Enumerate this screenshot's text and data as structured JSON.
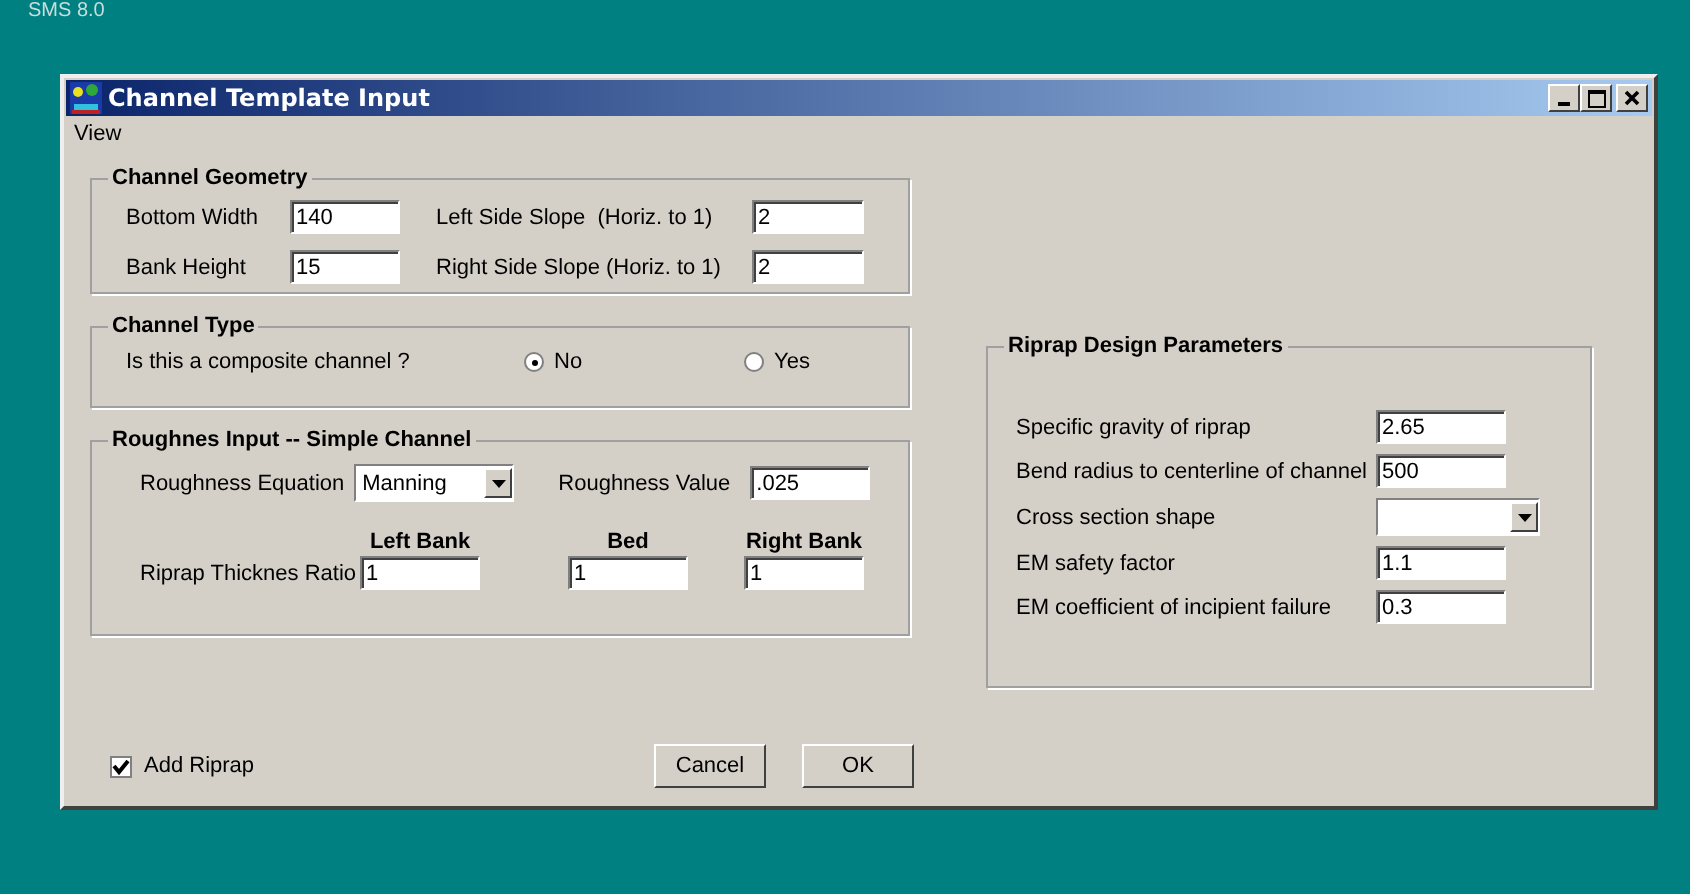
{
  "desktop_label": "SMS 8.0",
  "window": {
    "title": "Channel Template Input",
    "menu": [
      "View"
    ]
  },
  "geometry": {
    "title": "Channel Geometry",
    "fields": [
      {
        "label": "Bottom Width",
        "value": "140"
      },
      {
        "label": "Left Side Slope  (Horiz. to 1)",
        "value": "2"
      },
      {
        "label": "Bank Height",
        "value": "15"
      },
      {
        "label": "Right Side Slope (Horiz. to 1)",
        "value": "2"
      }
    ]
  },
  "channel_type": {
    "title": "Channel Type",
    "question": "Is this a composite channel ?",
    "options": [
      {
        "label": "No",
        "selected": true
      },
      {
        "label": "Yes",
        "selected": false
      }
    ]
  },
  "roughness": {
    "title": "Roughnes Input -- Simple Channel",
    "equation_label": "Roughness Equation",
    "equation_value": "Manning",
    "value_label": "Roughness Value",
    "value": ".025",
    "thickness_label": "Riprap Thicknes Ratio",
    "columns": [
      {
        "heading": "Left Bank",
        "value": "1"
      },
      {
        "heading": "Bed",
        "value": "1"
      },
      {
        "heading": "Right Bank",
        "value": "1"
      }
    ]
  },
  "riprap": {
    "title": "Riprap Design Parameters",
    "fields": [
      {
        "label": "Specific gravity of riprap",
        "value": "2.65",
        "kind": "text"
      },
      {
        "label": "Bend radius to centerline of channel",
        "value": "500",
        "kind": "text"
      },
      {
        "label": "Cross section shape",
        "kind": "dropdown"
      },
      {
        "label": "EM safety factor",
        "value": "1.1",
        "kind": "text"
      },
      {
        "label": "EM coefficient of incipient failure",
        "value": "0.3",
        "kind": "text"
      }
    ]
  },
  "add_riprap": {
    "label": "Add Riprap",
    "checked": true
  },
  "buttons": [
    "Cancel",
    "OK"
  ]
}
